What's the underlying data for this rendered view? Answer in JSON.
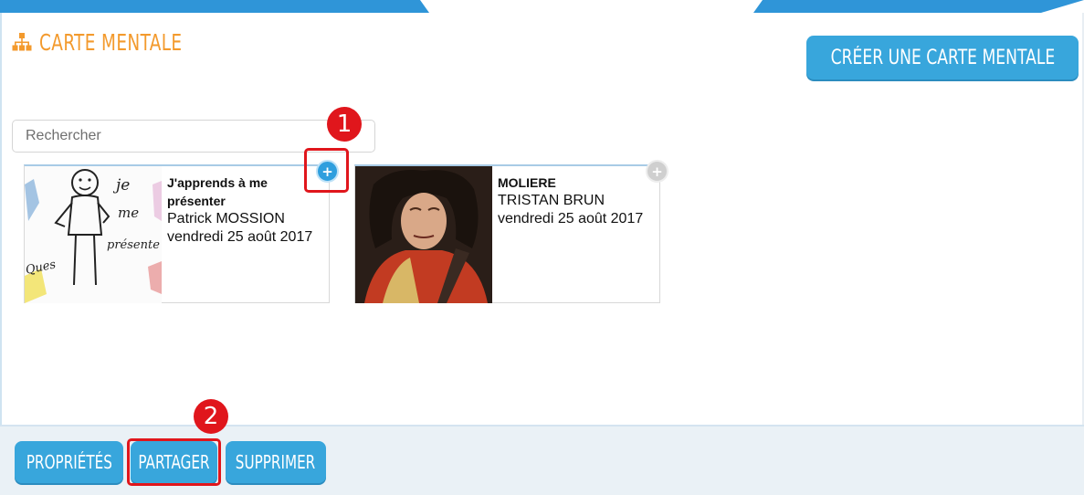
{
  "header": {
    "title": "CARTE MENTALE",
    "icon": "sitemap-icon",
    "create_label": "CRÉER UNE CARTE MENTALE"
  },
  "search": {
    "placeholder": "Rechercher"
  },
  "cards": [
    {
      "title": "J'apprends à me présenter",
      "author": "Patrick MOSSION",
      "date": "vendredi 25 août 2017"
    },
    {
      "title": "MOLIERE",
      "author": "TRISTAN BRUN",
      "date": "vendredi 25 août 2017"
    }
  ],
  "thumbnail_text": [
    "je",
    "me",
    "présente",
    "Ques"
  ],
  "markers": [
    "1",
    "2"
  ],
  "footer": {
    "properties_label": "PROPRIÉTÉS",
    "share_label": "PARTAGER",
    "delete_label": "SUPPRIMER"
  },
  "colors": {
    "accent": "#38a6dc",
    "title": "#f39a2d",
    "marker": "#e0161c"
  }
}
